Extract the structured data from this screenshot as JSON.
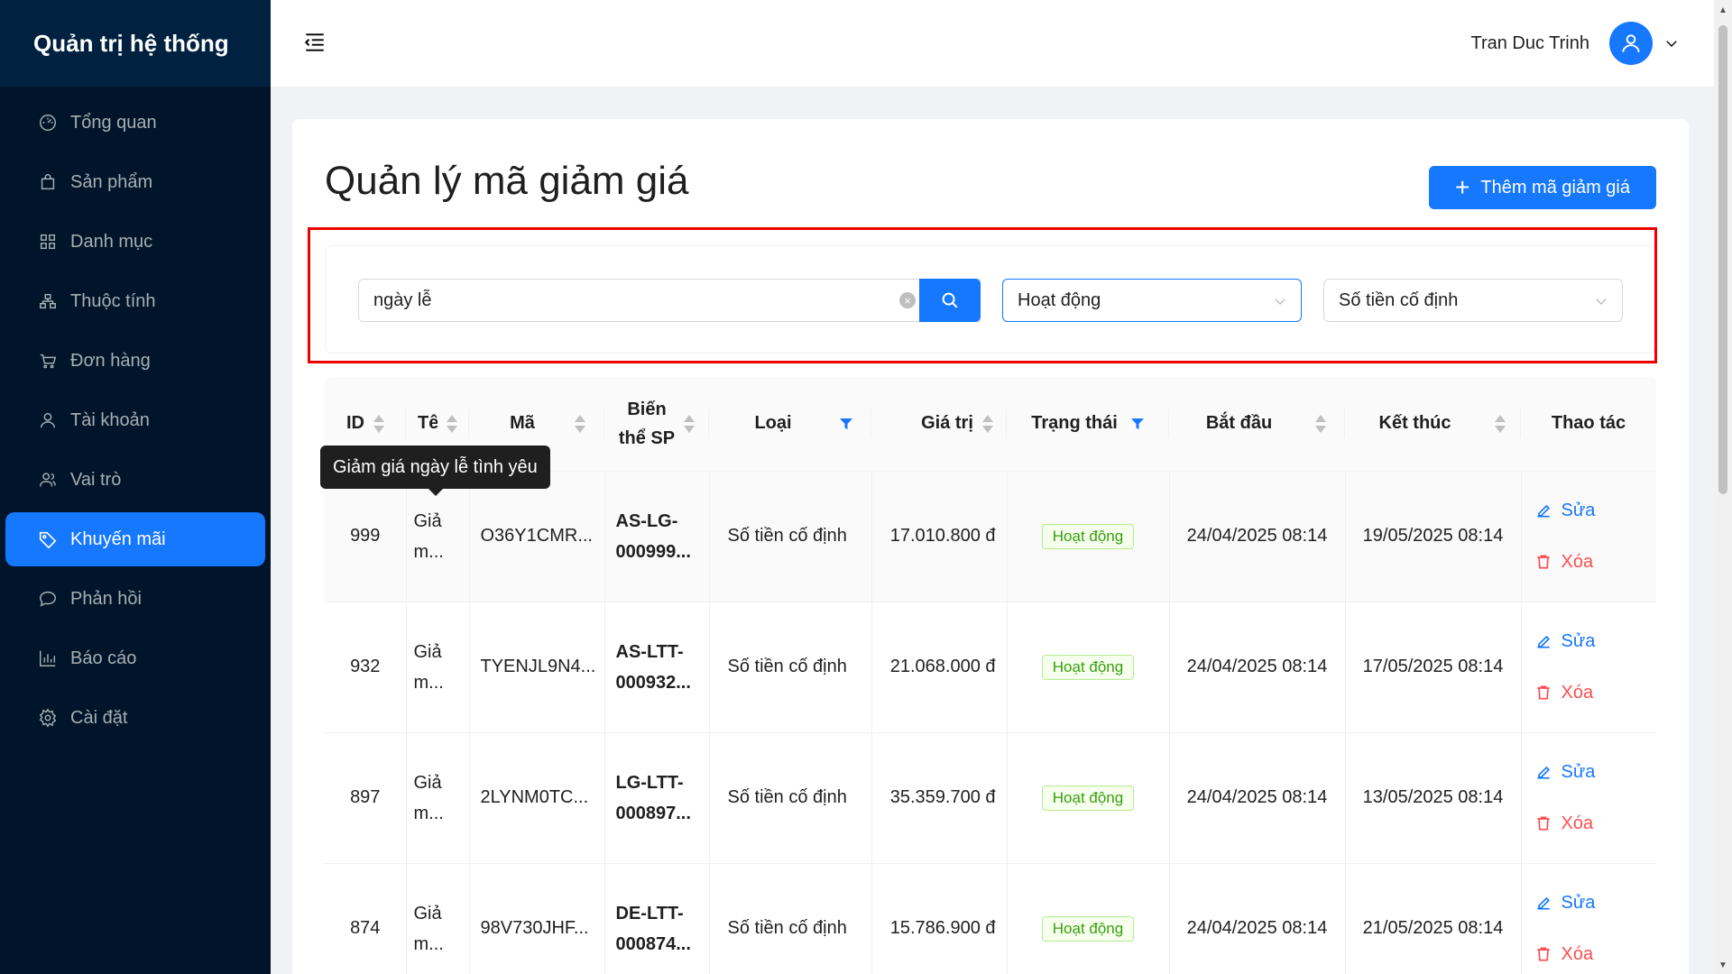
{
  "sidebar": {
    "brand": "Quản trị hệ thống",
    "items": [
      {
        "label": "Tổng quan",
        "icon": "dashboard-icon"
      },
      {
        "label": "Sản phẩm",
        "icon": "shopping-bag-icon"
      },
      {
        "label": "Danh mục",
        "icon": "grid-icon"
      },
      {
        "label": "Thuộc tính",
        "icon": "cluster-icon"
      },
      {
        "label": "Đơn hàng",
        "icon": "cart-icon"
      },
      {
        "label": "Tài khoản",
        "icon": "user-icon"
      },
      {
        "label": "Vai trò",
        "icon": "team-icon"
      },
      {
        "label": "Khuyến mãi",
        "icon": "tag-icon",
        "active": true
      },
      {
        "label": "Phản hồi",
        "icon": "comment-icon"
      },
      {
        "label": "Báo cáo",
        "icon": "bar-chart-icon"
      },
      {
        "label": "Cài đặt",
        "icon": "setting-icon"
      }
    ]
  },
  "header": {
    "user_name": "Tran Duc Trinh"
  },
  "page": {
    "title": "Quản lý mã giảm giá",
    "add_button": "Thêm mã giảm giá"
  },
  "filters": {
    "search_value": "ngày lễ",
    "status_value": "Hoạt động",
    "type_value": "Số tiền cố định"
  },
  "table": {
    "headers": {
      "id": "ID",
      "name": "Tên",
      "code": "Mã",
      "variant_l1": "Biến",
      "variant_l2": "thể SP",
      "type": "Loại",
      "value": "Giá trị",
      "status": "Trạng thái",
      "start": "Bắt đầu",
      "end": "Kết thúc",
      "actions": "Thao tác"
    },
    "rows": [
      {
        "id": "999",
        "name": "Giả m...",
        "code": "O36Y1CMR...",
        "variant_l1": "AS-LG-",
        "variant_l2": "000999...",
        "type": "Số tiền cố định",
        "value": "17.010.800 đ",
        "status": "Hoạt động",
        "start": "24/04/2025 08:14",
        "end": "19/05/2025 08:14"
      },
      {
        "id": "932",
        "name": "Giả m...",
        "code": "TYENJL9N4...",
        "variant_l1": "AS-LTT-",
        "variant_l2": "000932...",
        "type": "Số tiền cố định",
        "value": "21.068.000 đ",
        "status": "Hoạt động",
        "start": "24/04/2025 08:14",
        "end": "17/05/2025 08:14"
      },
      {
        "id": "897",
        "name": "Giả m...",
        "code": "2LYNM0TC...",
        "variant_l1": "LG-LTT-",
        "variant_l2": "000897...",
        "type": "Số tiền cố định",
        "value": "35.359.700 đ",
        "status": "Hoạt động",
        "start": "24/04/2025 08:14",
        "end": "13/05/2025 08:14"
      },
      {
        "id": "874",
        "name": "Giả m...",
        "code": "98V730JHF...",
        "variant_l1": "DE-LTT-",
        "variant_l2": "000874...",
        "type": "Số tiền cố định",
        "value": "15.786.900 đ",
        "status": "Hoạt động",
        "start": "24/04/2025 08:14",
        "end": "21/05/2025 08:14"
      }
    ],
    "edit_label": "Sửa",
    "delete_label": "Xóa"
  },
  "tooltip": "Giảm giá ngày lễ tình yêu",
  "colors": {
    "primary": "#1677ff",
    "sidebar": "#001529",
    "danger": "#ff4d4f",
    "highlight_border": "#e00000"
  }
}
